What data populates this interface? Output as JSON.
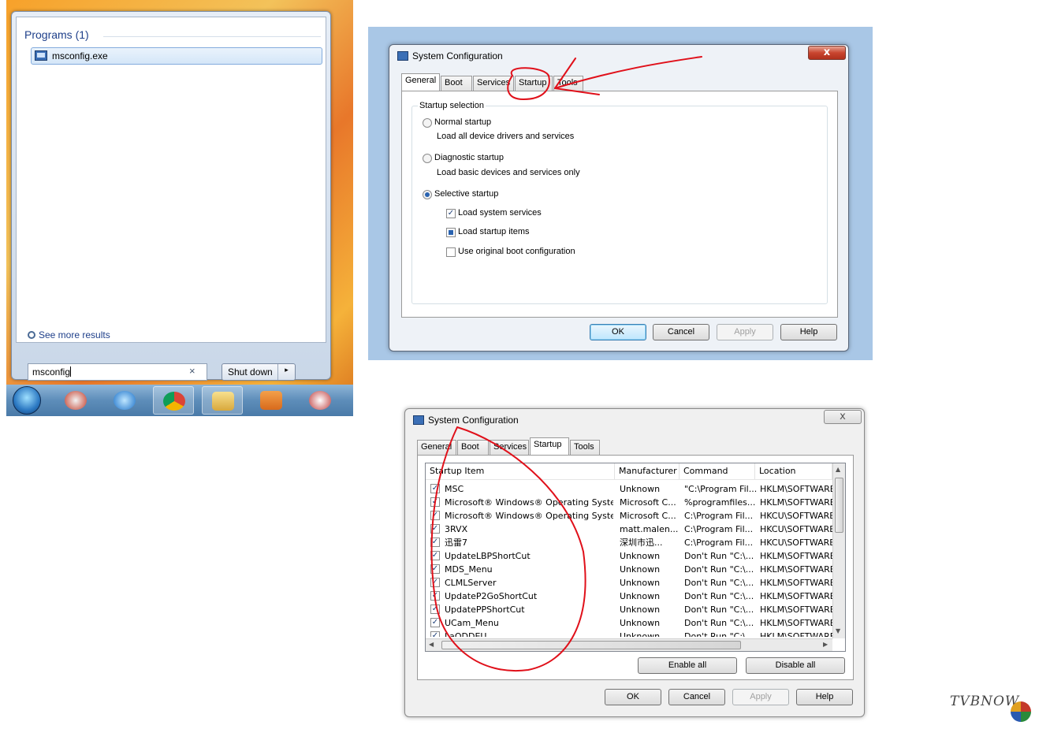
{
  "start_menu": {
    "programs_header": "Programs (1)",
    "program_item": "msconfig.exe",
    "see_more": "See more results",
    "search_value": "msconfig",
    "search_clear": "×",
    "shutdown_label": "Shut down",
    "shutdown_arrow": "▸"
  },
  "dialog1": {
    "title": "System Configuration",
    "close": "x",
    "tabs": [
      "General",
      "Boot",
      "Services",
      "Startup",
      "Tools"
    ],
    "group_label": "Startup selection",
    "normal_startup": "Normal startup",
    "normal_desc": "Load all device drivers and services",
    "diagnostic_startup": "Diagnostic startup",
    "diagnostic_desc": "Load basic devices and services only",
    "selective_startup": "Selective startup",
    "load_system_services": "Load system services",
    "load_startup_items": "Load startup items",
    "use_original_boot": "Use original boot configuration",
    "buttons": {
      "ok": "OK",
      "cancel": "Cancel",
      "apply": "Apply",
      "help": "Help"
    }
  },
  "dialog2": {
    "title": "System Configuration",
    "close": "x",
    "tabs": [
      "General",
      "Boot",
      "Services",
      "Startup",
      "Tools"
    ],
    "columns": [
      "Startup Item",
      "Manufacturer",
      "Command",
      "Location"
    ],
    "rows": [
      [
        "MSC",
        "Unknown",
        "\"C:\\Program Fil...",
        "HKLM\\SOFTWARE"
      ],
      [
        "Microsoft® Windows® Operating System",
        "Microsoft C...",
        "%programfiles...",
        "HKLM\\SOFTWARE"
      ],
      [
        "Microsoft® Windows® Operating System",
        "Microsoft C...",
        "C:\\Program Fil...",
        "HKCU\\SOFTWARE"
      ],
      [
        "3RVX",
        "matt.malen...",
        "C:\\Program Fil...",
        "HKCU\\SOFTWARE"
      ],
      [
        "迅雷7",
        "深圳市迅...",
        "C:\\Program Fil...",
        "HKCU\\SOFTWARE"
      ],
      [
        "UpdateLBPShortCut",
        "Unknown",
        "Don't Run \"C:\\...",
        "HKLM\\SOFTWARE"
      ],
      [
        "MDS_Menu",
        "Unknown",
        "Don't Run \"C:\\...",
        "HKLM\\SOFTWARE"
      ],
      [
        "CLMLServer",
        "Unknown",
        "Don't Run \"C:\\...",
        "HKLM\\SOFTWARE"
      ],
      [
        "UpdateP2GoShortCut",
        "Unknown",
        "Don't Run \"C:\\...",
        "HKLM\\SOFTWARE"
      ],
      [
        "UpdatePPShortCut",
        "Unknown",
        "Don't Run \"C:\\...",
        "HKLM\\SOFTWARE"
      ],
      [
        "UCam_Menu",
        "Unknown",
        "Don't Run \"C:\\...",
        "HKLM\\SOFTWARE"
      ],
      [
        "LaODDEU",
        "Unknown",
        "Don't Run \"C:\\...",
        "HKLM\\SOFTWARE"
      ]
    ],
    "enable_all": "Enable all",
    "disable_all": "Disable all",
    "buttons": {
      "ok": "OK",
      "cancel": "Cancel",
      "apply": "Apply",
      "help": "Help"
    }
  },
  "watermark": "TVBNOW",
  "colors": {
    "annotation": "#e0101a",
    "accent": "#3b6fb6"
  }
}
